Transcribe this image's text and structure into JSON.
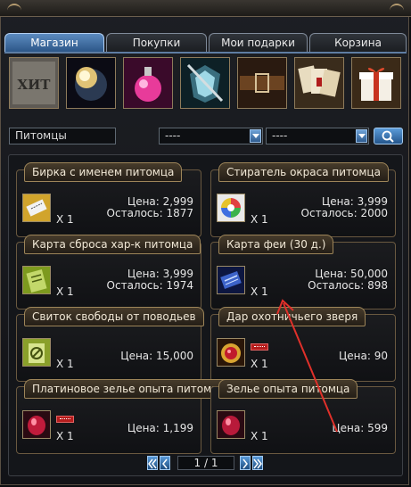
{
  "tabs": [
    {
      "label": "Магазин",
      "active": true
    },
    {
      "label": "Покупки",
      "active": false
    },
    {
      "label": "Мои подарки",
      "active": false
    },
    {
      "label": "Корзина",
      "active": false
    }
  ],
  "categories": [
    {
      "name": "hit-category-icon",
      "caption": "ХИТ"
    },
    {
      "name": "planet-category-icon"
    },
    {
      "name": "potion-category-icon"
    },
    {
      "name": "armor-category-icon"
    },
    {
      "name": "belt-category-icon"
    },
    {
      "name": "cards-category-icon"
    },
    {
      "name": "gift-category-icon"
    }
  ],
  "filters": {
    "category_value": "Питомцы",
    "subcategory_value": "----",
    "sort_value": "----"
  },
  "items": [
    {
      "title": "Бирка с именем питомца",
      "qty": "X 1",
      "price": "Цена: 2,999",
      "left": "Осталось: 1877",
      "hot": false,
      "icon": "name-tag-icon"
    },
    {
      "title": "Стиратель окраса питомца",
      "qty": "X 1",
      "price": "Цена: 3,999",
      "left": "Осталось: 2000",
      "hot": false,
      "icon": "color-eraser-icon"
    },
    {
      "title": "Карта сброса хар-к питомца",
      "qty": "X 1",
      "price": "Цена: 3,999",
      "left": "Осталось: 1974",
      "hot": false,
      "icon": "reset-card-icon"
    },
    {
      "title": "Карта феи (30 д.)",
      "qty": "X 1",
      "price": "Цена: 50,000",
      "left": "Осталось: 898",
      "hot": false,
      "icon": "fairy-card-icon"
    },
    {
      "title": "Свиток свободы от поводьев",
      "qty": "X 1",
      "price": "Цена: 15,000",
      "left": "",
      "hot": false,
      "icon": "freedom-scroll-icon"
    },
    {
      "title": "Дар охотничьего зверя",
      "qty": "X 1",
      "price": "Цена: 90",
      "left": "",
      "hot": true,
      "icon": "hunter-gift-icon"
    },
    {
      "title": "Платиновое зелье опыта питомца",
      "qty": "X 1",
      "price": "Цена: 1,199",
      "left": "",
      "hot": true,
      "icon": "platinum-exp-potion-icon"
    },
    {
      "title": "Зелье опыта питомца",
      "qty": "X 1",
      "price": "Цена: 599",
      "left": "",
      "hot": false,
      "icon": "exp-potion-icon"
    }
  ],
  "pager": {
    "indicator": "1 / 1"
  },
  "colors": {
    "active_tab": "#2a5485",
    "annotation_arrow": "#e0302a",
    "card_border": "#6a5940"
  }
}
